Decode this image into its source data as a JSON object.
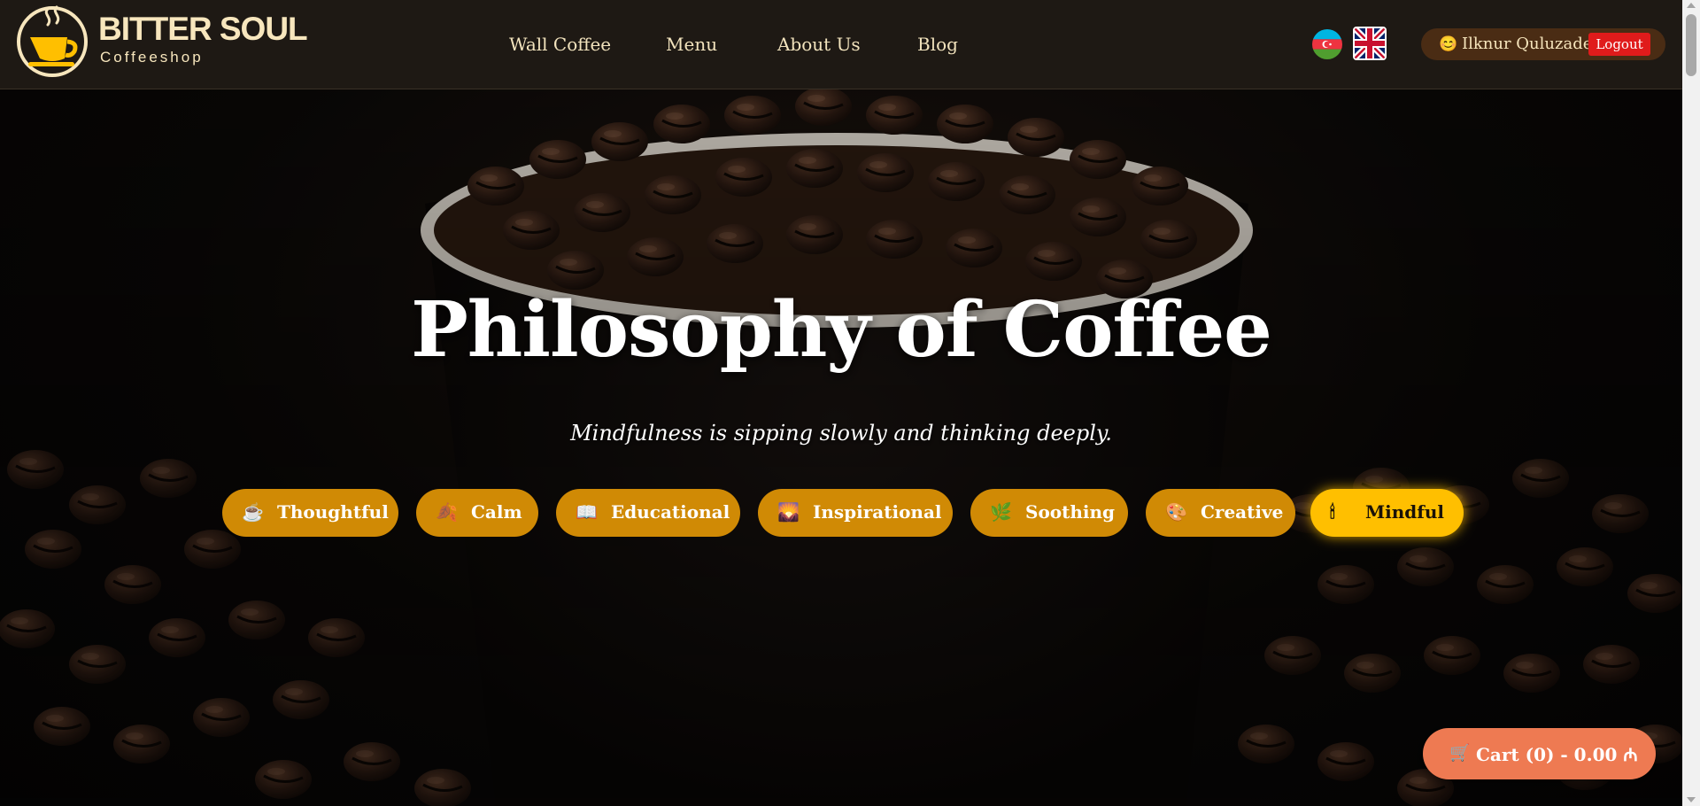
{
  "brand": {
    "name": "BITTER SOUL",
    "subtitle": "Coffeeshop"
  },
  "nav": [
    "Wall Coffee",
    "Menu",
    "About Us",
    "Blog"
  ],
  "languages": [
    "az-flag-icon",
    "uk-flag-icon"
  ],
  "user": {
    "emoji": "😊",
    "name": "Ilknur Quluzade",
    "logout_label": "Logout"
  },
  "hero": {
    "title": "Philosophy of Coffee",
    "subtitle": "Mindfulness is sipping slowly and thinking deeply."
  },
  "moods": [
    {
      "icon": "☕",
      "label": "Thoughtful",
      "active": false
    },
    {
      "icon": "🍂",
      "label": "Calm",
      "active": false
    },
    {
      "icon": "📖",
      "label": "Educational",
      "active": false
    },
    {
      "icon": "🌄",
      "label": "Inspirational",
      "active": false
    },
    {
      "icon": "🌿",
      "label": "Soothing",
      "active": false
    },
    {
      "icon": "🎨",
      "label": "Creative",
      "active": false
    },
    {
      "icon": "🕯",
      "label": "Mindful",
      "active": true
    }
  ],
  "cart": {
    "icon": "🛒",
    "label": "Cart (0) - 0.00 ₼"
  },
  "colors": {
    "header_bg": "#1e1914",
    "mood_button": "#d08a05",
    "mood_active": "#ffbf00",
    "cart_button": "#ee7a52",
    "logout_button": "#e01b1b"
  }
}
